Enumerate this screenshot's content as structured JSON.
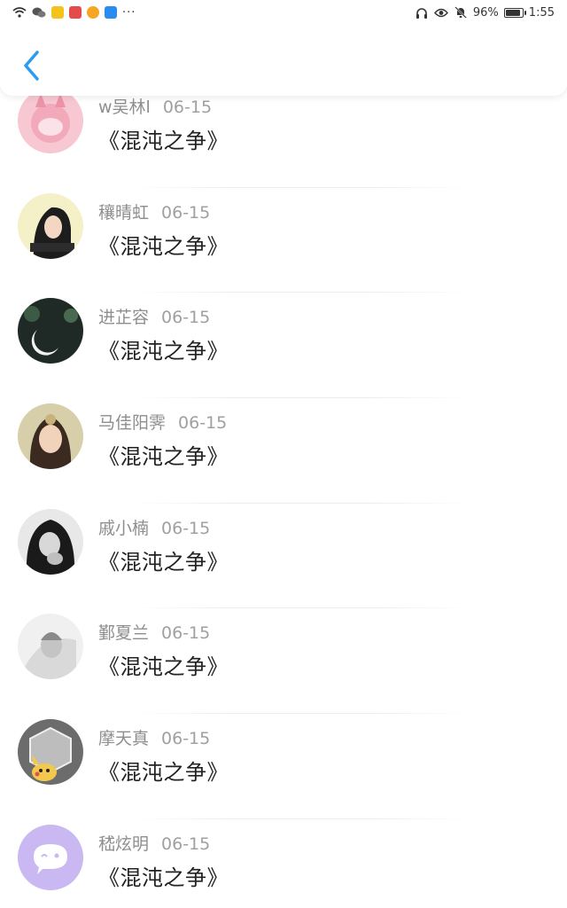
{
  "status_bar": {
    "battery": "96%",
    "time": "1:55",
    "battery_level": 0.96
  },
  "header": {
    "back_icon": "chevron-left-icon",
    "accent": "#2b9cf0"
  },
  "items": [
    {
      "name": "w吴林l",
      "date": "06-15",
      "title": "《混沌之争》"
    },
    {
      "name": "穰晴虹",
      "date": "06-15",
      "title": "《混沌之争》"
    },
    {
      "name": "进芷容",
      "date": "06-15",
      "title": "《混沌之争》"
    },
    {
      "name": "马佳阳霁",
      "date": "06-15",
      "title": "《混沌之争》"
    },
    {
      "name": "戚小楠",
      "date": "06-15",
      "title": "《混沌之争》"
    },
    {
      "name": "鄞夏兰",
      "date": "06-15",
      "title": "《混沌之争》"
    },
    {
      "name": "摩天真",
      "date": "06-15",
      "title": "《混沌之争》"
    },
    {
      "name": "嵇炫明",
      "date": "06-15",
      "title": "《混沌之争》"
    }
  ]
}
